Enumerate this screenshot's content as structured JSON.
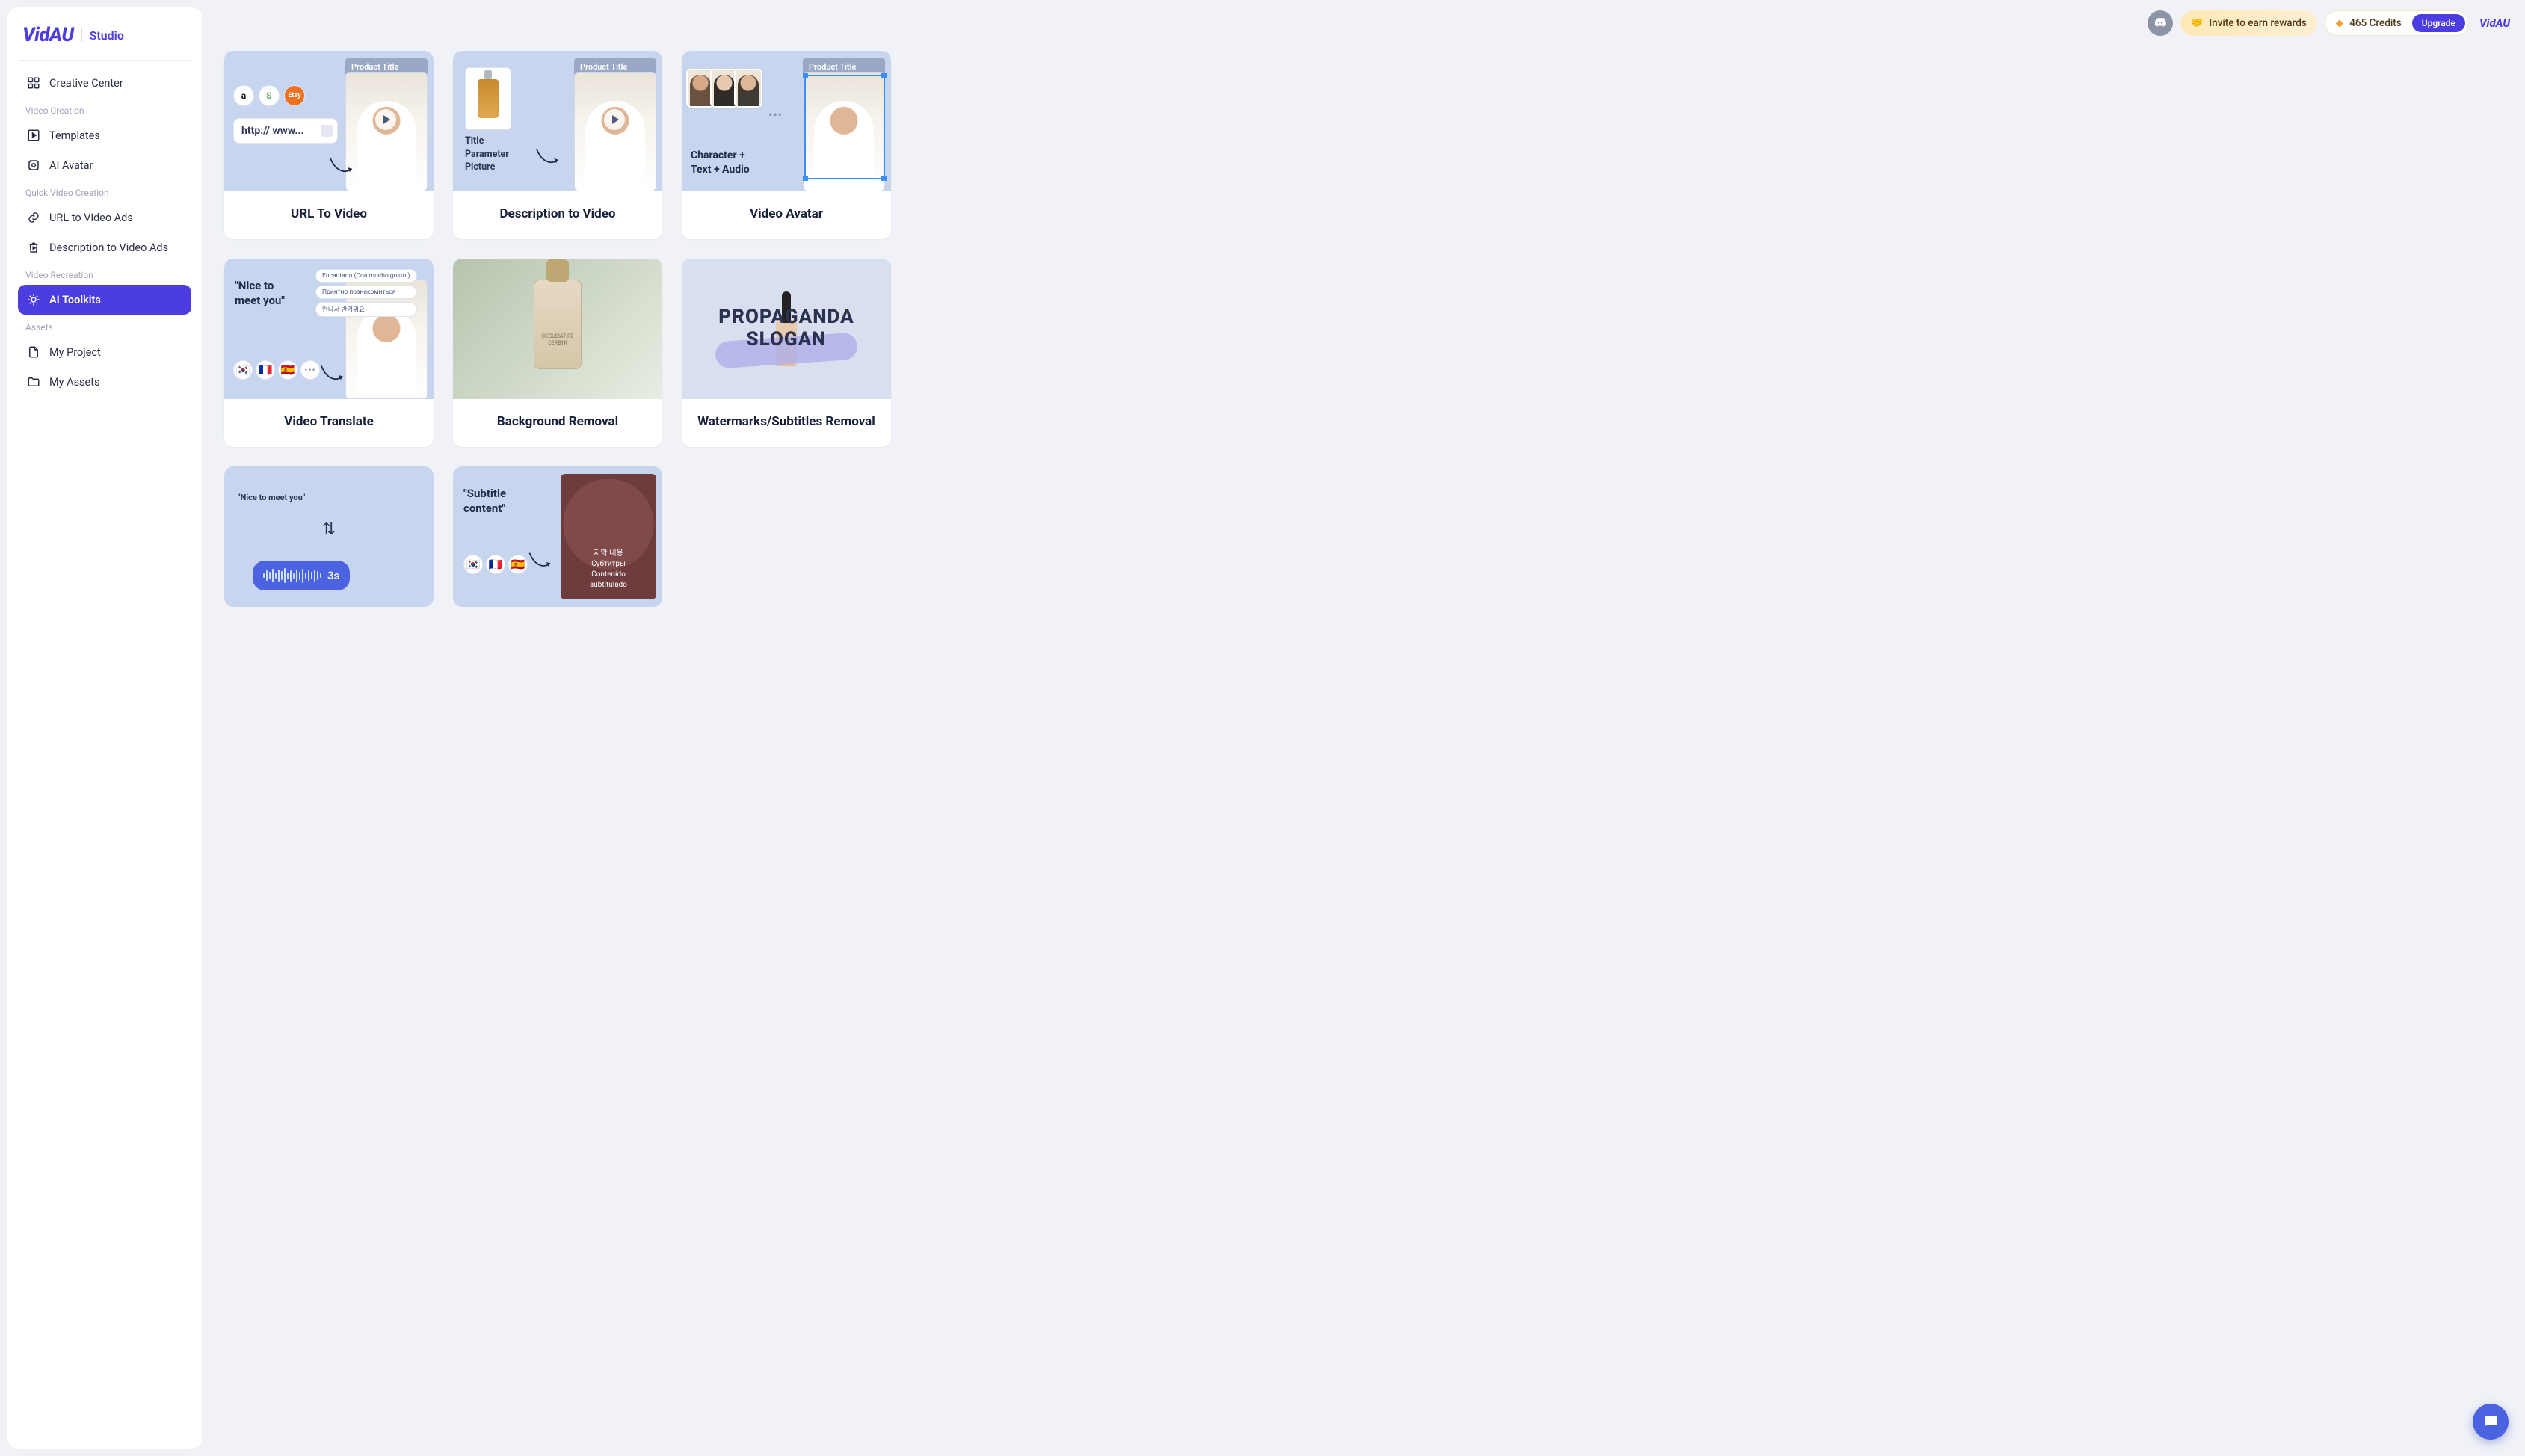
{
  "brand": {
    "name": "VidAU",
    "sub": "Studio"
  },
  "topbar": {
    "invite_label": "Invite to earn rewards",
    "credits_label": "465 Credits",
    "upgrade_label": "Upgrade"
  },
  "sidebar": {
    "creative_center": "Creative Center",
    "sections": {
      "video_creation": "Video Creation",
      "quick_video_creation": "Quick Video Creation",
      "video_recreation": "Video Recreation",
      "assets": "Assets"
    },
    "items": {
      "templates": "Templates",
      "ai_avatar": "AI Avatar",
      "url_to_video_ads": "URL to Video Ads",
      "description_to_video_ads": "Description to Video Ads",
      "ai_toolkits": "AI Toolkits",
      "my_project": "My Project",
      "my_assets": "My Assets"
    }
  },
  "cards": {
    "url_to_video": {
      "title": "URL To Video",
      "banner": "Product Title",
      "url_sample": "http:// www...",
      "marketplaces": [
        "a",
        "S",
        "Etsy"
      ]
    },
    "description_to_video": {
      "title": "Description to Video",
      "banner": "Product Title",
      "meta_lines": "Title\nParameter\nPicture"
    },
    "video_avatar": {
      "title": "Video Avatar",
      "banner": "Product Title",
      "caption": "Character +\nText + Audio"
    },
    "video_translate": {
      "title": "Video Translate",
      "quote": "\"Nice to\nmeet you\"",
      "bubbles": [
        "Encantado.(Con mucho gusto.)",
        "Приятно познакомиться",
        "만나서 반가워요"
      ]
    },
    "background_removal": {
      "title": "Background Removal",
      "bottle_label": "CCCUSIATIRE\nCERB1K"
    },
    "watermark_removal": {
      "title": "Watermarks/Subtitles Removal",
      "overlay_line1": "PROPAGANDA",
      "overlay_line2": "SLOGAN"
    },
    "audio_clone": {
      "quote": "\"Nice to meet you\"",
      "duration": "3s"
    },
    "subtitle_translate": {
      "quote": "\"Subtitle\ncontent\"",
      "lines": "자막 내용\nСубтитры\nContenido\nsubtitulado"
    }
  }
}
